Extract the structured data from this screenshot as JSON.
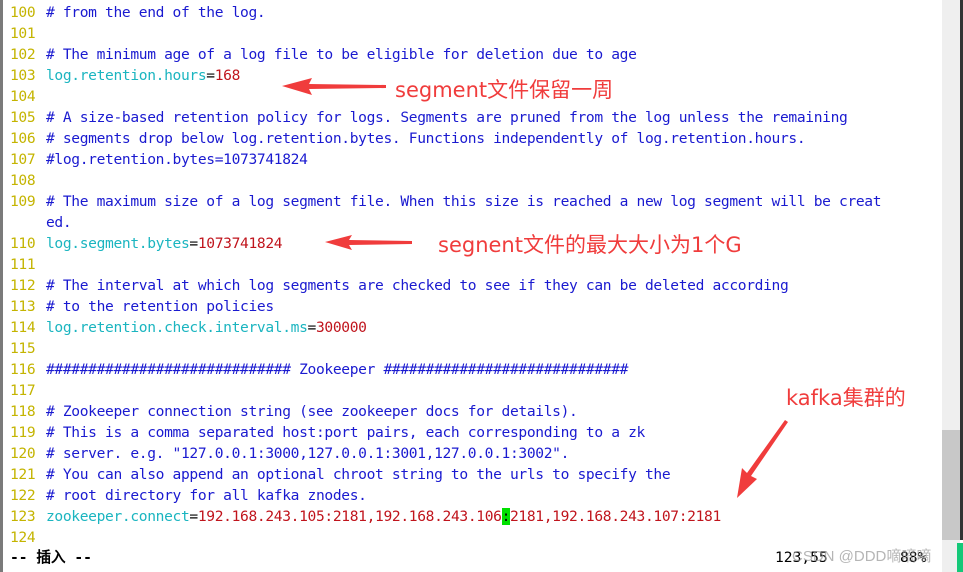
{
  "editor": {
    "lines": [
      {
        "num": "100",
        "parts": [
          {
            "t": "# from the end of the log.",
            "c": "cmt"
          }
        ]
      },
      {
        "num": "101",
        "parts": []
      },
      {
        "num": "102",
        "parts": [
          {
            "t": "# The minimum age of a log file to be eligible for deletion due to age",
            "c": "cmt"
          }
        ]
      },
      {
        "num": "103",
        "parts": [
          {
            "t": "log.retention.hours",
            "c": "key"
          },
          {
            "t": "=",
            "c": "eq"
          },
          {
            "t": "168",
            "c": "val"
          }
        ]
      },
      {
        "num": "104",
        "parts": []
      },
      {
        "num": "105",
        "parts": [
          {
            "t": "# A size-based retention policy for logs. Segments are pruned from the log unless the remaining",
            "c": "cmt"
          }
        ]
      },
      {
        "num": "106",
        "parts": [
          {
            "t": "# segments drop below log.retention.bytes. Functions independently of log.retention.hours.",
            "c": "cmt"
          }
        ]
      },
      {
        "num": "107",
        "parts": [
          {
            "t": "#log.retention.bytes=1073741824",
            "c": "cmt"
          }
        ]
      },
      {
        "num": "108",
        "parts": []
      },
      {
        "num": "109",
        "parts": [
          {
            "t": "# The maximum size of a log segment file. When this size is reached a new log segment will be creat",
            "c": "cmt"
          }
        ]
      },
      {
        "num": "",
        "parts": [
          {
            "t": "ed.",
            "c": "cmt"
          }
        ]
      },
      {
        "num": "110",
        "parts": [
          {
            "t": "log.segment.bytes",
            "c": "key"
          },
          {
            "t": "=",
            "c": "eq"
          },
          {
            "t": "1073741824",
            "c": "val"
          }
        ]
      },
      {
        "num": "111",
        "parts": []
      },
      {
        "num": "112",
        "parts": [
          {
            "t": "# The interval at which log segments are checked to see if they can be deleted according",
            "c": "cmt"
          }
        ]
      },
      {
        "num": "113",
        "parts": [
          {
            "t": "# to the retention policies",
            "c": "cmt"
          }
        ]
      },
      {
        "num": "114",
        "parts": [
          {
            "t": "log.retention.check.interval.ms",
            "c": "key"
          },
          {
            "t": "=",
            "c": "eq"
          },
          {
            "t": "300000",
            "c": "val"
          }
        ]
      },
      {
        "num": "115",
        "parts": []
      },
      {
        "num": "116",
        "parts": [
          {
            "t": "############################# Zookeeper #############################",
            "c": "cmt"
          }
        ]
      },
      {
        "num": "117",
        "parts": []
      },
      {
        "num": "118",
        "parts": [
          {
            "t": "# Zookeeper connection string (see zookeeper docs for details).",
            "c": "cmt"
          }
        ]
      },
      {
        "num": "119",
        "parts": [
          {
            "t": "# This is a comma separated host:port pairs, each corresponding to a zk",
            "c": "cmt"
          }
        ]
      },
      {
        "num": "120",
        "parts": [
          {
            "t": "# server. e.g. \"127.0.0.1:3000,127.0.0.1:3001,127.0.0.1:3002\".",
            "c": "cmt"
          }
        ]
      },
      {
        "num": "121",
        "parts": [
          {
            "t": "# You can also append an optional chroot string to the urls to specify the",
            "c": "cmt"
          }
        ]
      },
      {
        "num": "122",
        "parts": [
          {
            "t": "# root directory for all kafka znodes.",
            "c": "cmt"
          }
        ]
      },
      {
        "num": "123",
        "parts": [
          {
            "t": "zookeeper.connect",
            "c": "key"
          },
          {
            "t": "=",
            "c": "eq"
          },
          {
            "t": "192.168.243.105:2181,192.168.243.106",
            "c": "val"
          },
          {
            "t": ":",
            "c": "cursor"
          },
          {
            "t": "2181,192.168.243.107:2181",
            "c": "val"
          }
        ]
      },
      {
        "num": "124",
        "parts": []
      }
    ]
  },
  "statusbar": {
    "mode": "-- 插入 --",
    "position": "123,55",
    "percent": "88%"
  },
  "annotations": {
    "retention": "segment文件保留一周",
    "segment_size": "segnent文件的最大大小为1个G",
    "kafka_cluster": "kafka集群的"
  },
  "watermark": "CSDN @DDD嘀嘀嘀",
  "scrollbar": {
    "position_fraction": 0.88
  }
}
